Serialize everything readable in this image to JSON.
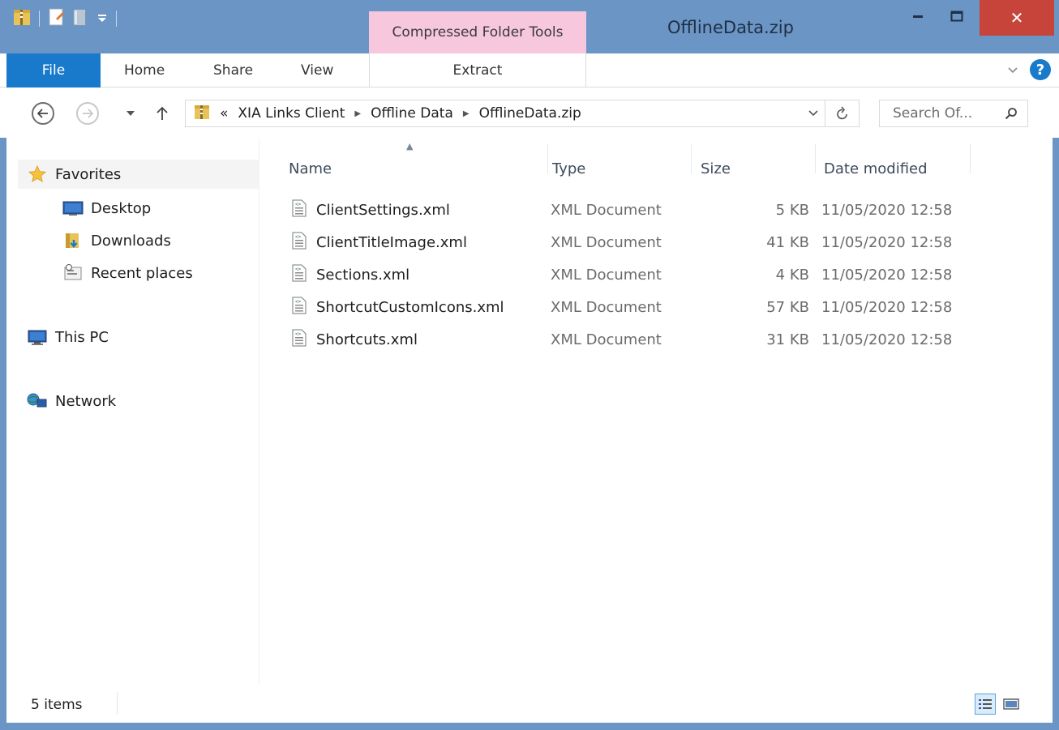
{
  "window": {
    "title": "OfflineData.zip",
    "contextual_tab_group": "Compressed Folder Tools",
    "close_symbol": "✕"
  },
  "ribbon": {
    "tabs": [
      "File",
      "Home",
      "Share",
      "View"
    ],
    "contextual_tab": "Extract"
  },
  "address": {
    "overflow": "«",
    "crumbs": [
      "XIA Links Client",
      "Offline Data",
      "OfflineData.zip"
    ],
    "search_placeholder": "Search Of..."
  },
  "nav_pane": {
    "favorites": "Favorites",
    "favorites_items": [
      "Desktop",
      "Downloads",
      "Recent places"
    ],
    "this_pc": "This PC",
    "network": "Network"
  },
  "columns": {
    "name": "Name",
    "type": "Type",
    "size": "Size",
    "date": "Date modified",
    "sort_indicator": "▲"
  },
  "files": [
    {
      "name": "ClientSettings.xml",
      "type": "XML Document",
      "size": "5 KB",
      "date": "11/05/2020 12:58"
    },
    {
      "name": "ClientTitleImage.xml",
      "type": "XML Document",
      "size": "41 KB",
      "date": "11/05/2020 12:58"
    },
    {
      "name": "Sections.xml",
      "type": "XML Document",
      "size": "4 KB",
      "date": "11/05/2020 12:58"
    },
    {
      "name": "ShortcutCustomIcons.xml",
      "type": "XML Document",
      "size": "57 KB",
      "date": "11/05/2020 12:58"
    },
    {
      "name": "Shortcuts.xml",
      "type": "XML Document",
      "size": "31 KB",
      "date": "11/05/2020 12:58"
    }
  ],
  "status": {
    "item_count": "5 items"
  },
  "colors": {
    "title_bar": "#6a95c4",
    "file_tab": "#1979ca",
    "contextual_tab": "#f6c7dd",
    "close_button": "#c6443a"
  }
}
